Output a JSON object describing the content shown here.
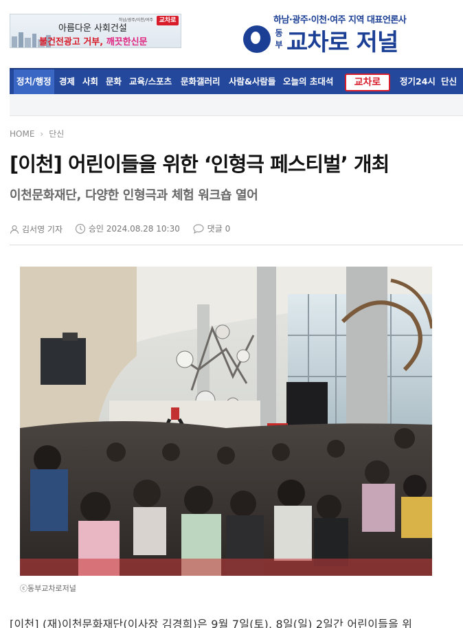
{
  "banner": {
    "small_text": "하남/광주/이천/여주",
    "logo_text": "교차로",
    "line1": "아름다운 사회건설",
    "line2_part1": "불건전광고 거부, ",
    "line2_part2": "깨끗한신문"
  },
  "masthead": {
    "tagline": "하남·광주·이천·여주 지역 대표언론사",
    "sub": "동부",
    "name": "교차로 저널"
  },
  "nav": {
    "items": [
      "정치/행정",
      "경제",
      "사회",
      "문화",
      "교육/스포츠",
      "문화갤러리",
      "사람&사람들",
      "오늘의 초대석",
      "정기24시",
      "단신"
    ],
    "logo_text": "교차로"
  },
  "breadcrumb": {
    "home": "HOME",
    "section": "단신"
  },
  "article": {
    "headline": "[이천] 어린이들을 위한 ‘인형극 페스티벌’ 개최",
    "subheadline": "이천문화재단, 다양한 인형극과 체험 워크숍 열어",
    "author": "김서영 기자",
    "approved": "승인 2024.08.28 10:30",
    "comments": "댓글 0",
    "photo_caption": "ⓒ동부교차로저널",
    "body_first_line": "[이천] (재)이천문화재단(이사장 김경희)은 9월 7일(토), 8일(일) 2일간 어린이들을 위"
  },
  "colors": {
    "nav_bg": "#23489c",
    "brand_blue": "#1b3f94",
    "brand_red": "#d81c2a"
  }
}
